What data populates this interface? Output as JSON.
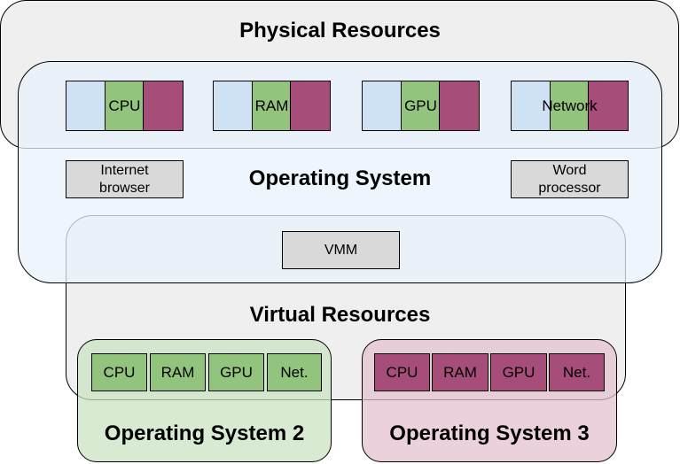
{
  "titles": {
    "physical": "Physical Resources",
    "os": "Operating System",
    "virtual": "Virtual Resources"
  },
  "physical_resources": [
    {
      "label": "CPU"
    },
    {
      "label": "RAM"
    },
    {
      "label": "GPU"
    },
    {
      "label": "Network"
    }
  ],
  "applications": [
    {
      "label": "Internet\nbrowser"
    },
    {
      "label": "Word\nprocessor"
    }
  ],
  "vmm": {
    "label": "VMM"
  },
  "guests": [
    {
      "title": "Operating System 2",
      "color": "#93c47d",
      "resources": [
        "CPU",
        "RAM",
        "GPU",
        "Net."
      ]
    },
    {
      "title": "Operating System 3",
      "color": "#a64d79",
      "resources": [
        "CPU",
        "RAM",
        "GPU",
        "Net."
      ]
    }
  ],
  "colors": {
    "physical_bg": "#efefef",
    "os_bg": "#eef5fd",
    "share_blue": "#cfe2f3",
    "share_green": "#93c47d",
    "share_plum": "#a64d79",
    "app_bg": "#d9d9d9",
    "guest2_bg": "#d9ead3",
    "guest3_bg": "#ead1dc"
  }
}
